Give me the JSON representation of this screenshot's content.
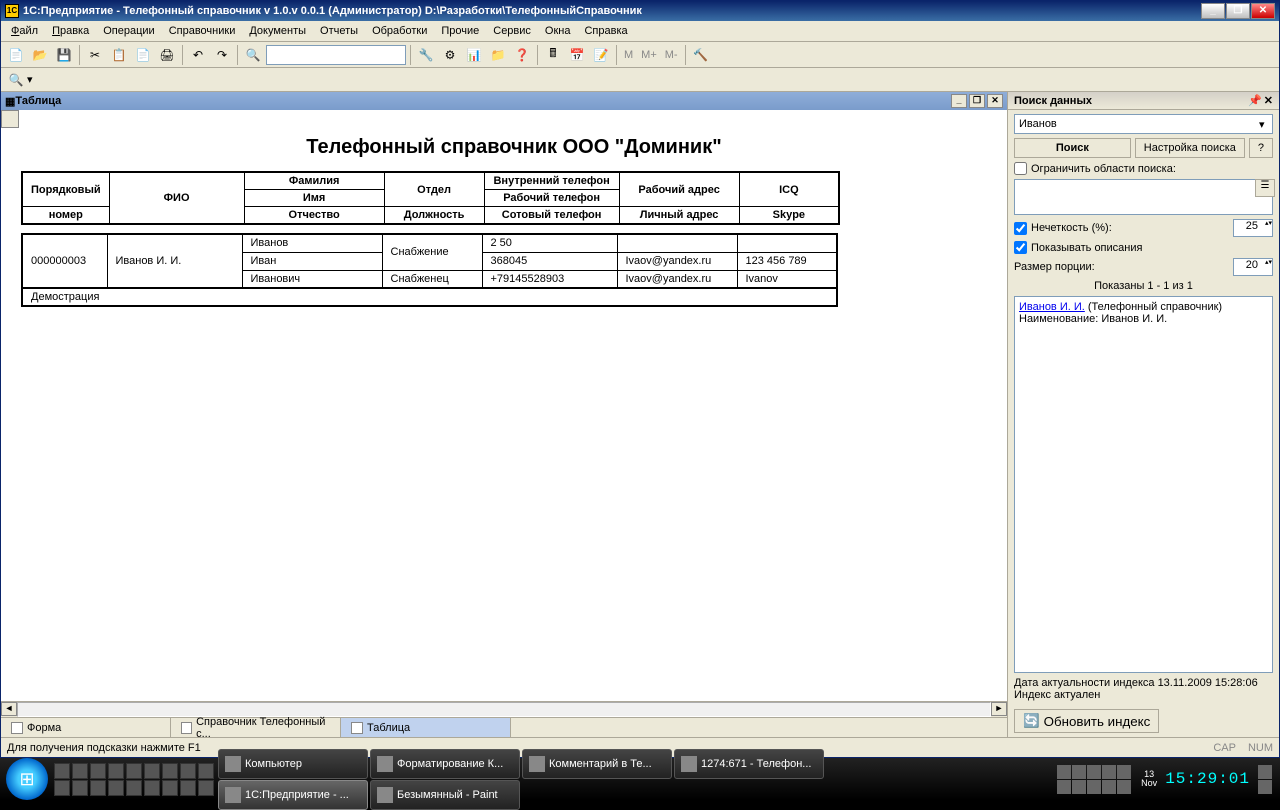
{
  "titlebar": {
    "title": "1С:Предприятие - Телефонный справочник v 1.0.v 0.0.1 (Администратор) D:\\Разработки\\ТелефонныйСправочник"
  },
  "menu": {
    "file": "Файл",
    "edit": "Правка",
    "operations": "Операции",
    "catalogs": "Справочники",
    "documents": "Документы",
    "reports": "Отчеты",
    "processing": "Обработки",
    "other": "Прочие",
    "service": "Сервис",
    "windows": "Окна",
    "help": "Справка"
  },
  "toolbar_text": {
    "m": "М",
    "mplus": "М+",
    "mminus": "М-"
  },
  "doc": {
    "tab_title": "Таблица"
  },
  "report": {
    "title": "Телефонный справочник  ООО  \"Доминик\"",
    "headers": {
      "seq_no_1": "Порядковый",
      "seq_no_2": "номер",
      "fio": "ФИО",
      "surname": "Фамилия",
      "name": "Имя",
      "patronym": "Отчество",
      "dept": "Отдел",
      "position": "Должность",
      "ph_int": "Внутренний телефон",
      "ph_work": "Рабочий телефон",
      "ph_cell": "Сотовый телефон",
      "addr_work": "Рабочий адрес",
      "addr_home": "Личный адрес",
      "icq": "ICQ",
      "skype": "Skype"
    },
    "row": {
      "seq": "000000003",
      "fio": "Иванов И. И.",
      "surname": "Иванов",
      "name": "Иван",
      "patronym": "Иванович",
      "dept": "Снабжение",
      "position": "Снабженец",
      "ph_int": "2 50",
      "ph_work": "368045",
      "ph_cell": "+79145528903",
      "addr_work": "Ivaov@yandex.ru",
      "addr_home": "Ivaov@yandex.ru",
      "icq": "123 456 789",
      "skype": "Ivanov"
    },
    "footer_label": "Демострация"
  },
  "tabs": {
    "t1": "Форма",
    "t2": "Справочник Телефонный с...",
    "t3": "Таблица"
  },
  "search": {
    "title": "Поиск данных",
    "input_value": "Иванов",
    "btn_search": "Поиск",
    "btn_settings": "Настройка поиска",
    "btn_help": "?",
    "limit_areas": "Ограничить области поиска:",
    "fuzzy": "Нечеткость (%):",
    "fuzzy_val": "25",
    "show_desc": "Показывать описания",
    "portion": "Размер порции:",
    "portion_val": "20",
    "shown": "Показаны 1 - 1 из 1",
    "result_link": "Иванов И. И.",
    "result_suffix": " (Телефонный справочник)",
    "result_desc": "Наименование: Иванов И. И.",
    "index_date": "Дата актуальности индекса 13.11.2009 15:28:06",
    "index_status": "Индекс актуален",
    "update_btn": "Обновить индекс"
  },
  "status": {
    "hint": "Для получения подсказки нажмите F1",
    "cap": "CAP",
    "num": "NUM"
  },
  "taskbar": {
    "t1": "Компьютер",
    "t2": "Форматирование К...",
    "t3": "Комментарий в Те...",
    "t4": "1274:671 - Телефон...",
    "t5": "1С:Предприятие - ...",
    "t6": "Безымянный - Paint"
  },
  "clock": {
    "date_d": "13",
    "date_m": "Nov",
    "time": "15:29:01"
  }
}
